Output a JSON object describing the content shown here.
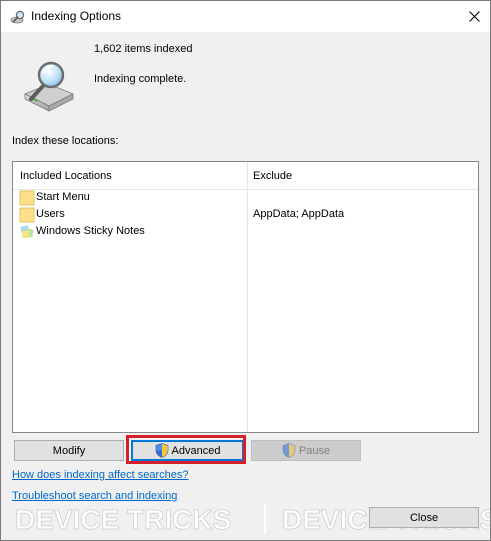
{
  "window": {
    "title": "Indexing Options"
  },
  "status": {
    "items_indexed": "1,602 items indexed",
    "state": "Indexing complete."
  },
  "locations": {
    "label": "Index these locations:",
    "columns": [
      "Included Locations",
      "Exclude"
    ],
    "rows": [
      {
        "name": "Start Menu",
        "exclude": "",
        "icon": "folder-icon"
      },
      {
        "name": "Users",
        "exclude": "AppData; AppData",
        "icon": "folder-icon"
      },
      {
        "name": "Windows Sticky Notes",
        "exclude": "",
        "icon": "sticky-notes-icon"
      }
    ]
  },
  "buttons": {
    "modify": "Modify",
    "advanced": "Advanced",
    "pause": "Pause",
    "close": "Close"
  },
  "links": {
    "affect": "How does indexing affect searches?",
    "troubleshoot": "Troubleshoot search and indexing"
  },
  "watermark": {
    "text_left": "DEVICE TRICKS",
    "text_right": "DEVICE TRICKS"
  },
  "colors": {
    "accent": "#0078d7",
    "highlight": "#d4202a",
    "link": "#0066cc",
    "dialog_bg": "#f0f0f0"
  }
}
